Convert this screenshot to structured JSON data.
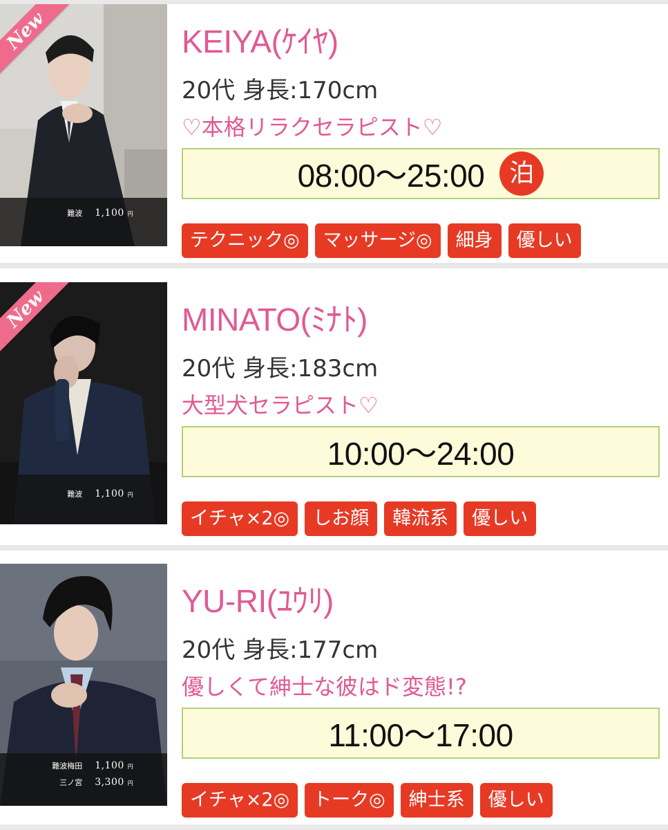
{
  "colors": {
    "name_pink": "#e05a93",
    "tag_red": "#e63a25",
    "hours_bg": "#fdfbd9",
    "hours_border": "#b5cf7e",
    "ribbon_pink": "#ef6b8c"
  },
  "therapists": [
    {
      "name": "KEIYA(ｹｲﾔ)",
      "spec": "20代 身長:170cm",
      "catchphrase": "♡本格リラクセラピスト♡",
      "hours": "08:00〜25:00",
      "stay_badge": "泊",
      "new_badge": "New",
      "tags": [
        "テクニック◎",
        "マッサージ◎",
        "細身",
        "優しい"
      ],
      "photo_prices": [
        {
          "area": "難波",
          "price": "1,100",
          "unit": "円"
        }
      ]
    },
    {
      "name": "MINATO(ﾐﾅﾄ)",
      "spec": "20代 身長:183cm",
      "catchphrase": "大型犬セラピスト♡",
      "hours": "10:00〜24:00",
      "new_badge": "New",
      "tags": [
        "イチャ×2◎",
        "しお顔",
        "韓流系",
        "優しい"
      ],
      "photo_prices": [
        {
          "area": "難波",
          "price": "1,100",
          "unit": "円"
        }
      ]
    },
    {
      "name": "YU-RI(ﾕｳﾘ)",
      "spec": "20代 身長:177cm",
      "catchphrase": "優しくて紳士な彼はド変態!?",
      "hours": "11:00〜17:00",
      "tags": [
        "イチャ×2◎",
        "トーク◎",
        "紳士系",
        "優しい"
      ],
      "photo_prices": [
        {
          "area": "難波梅田",
          "price": "1,100",
          "unit": "円"
        },
        {
          "area": "三ノ宮",
          "price": "3,300",
          "unit": "円"
        }
      ]
    }
  ]
}
